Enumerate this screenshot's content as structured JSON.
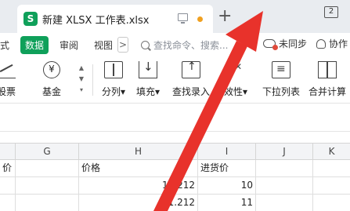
{
  "tab": {
    "logo": "S",
    "title": "新建 XLSX 工作表.xlsx",
    "new_tab": "+"
  },
  "window": {
    "count": "2"
  },
  "menu": {
    "items": [
      {
        "label": "式",
        "active": false
      },
      {
        "label": "数据",
        "active": true
      },
      {
        "label": "审阅",
        "active": false
      },
      {
        "label": "视图",
        "active": false
      }
    ],
    "more": ">",
    "search_text": "查找命令、搜索...",
    "sync_label": "未同步",
    "collab_label": "协作"
  },
  "ribbon": {
    "stock": "股票",
    "fund": "基金",
    "fund_symbol": "¥",
    "split": "分列",
    "fill": "填充",
    "find_entry": "查找录入",
    "validity": "效性",
    "dropdown": "下拉列表",
    "merge": "合并计算"
  },
  "grid": {
    "columns": [
      "G",
      "H",
      "I",
      "J",
      "K"
    ],
    "rows": [
      {
        "f": "价",
        "g": "",
        "h": "价格",
        "i": "进货价"
      },
      {
        "f": "",
        "g": "",
        "h": "10.212",
        "i": "10"
      },
      {
        "f": "",
        "g": "",
        "h": "11.212",
        "i": "11"
      }
    ]
  },
  "colors": {
    "accent": "#0fa05a",
    "arrow": "#e8322b",
    "unsaved_dot": "#f0a020"
  }
}
